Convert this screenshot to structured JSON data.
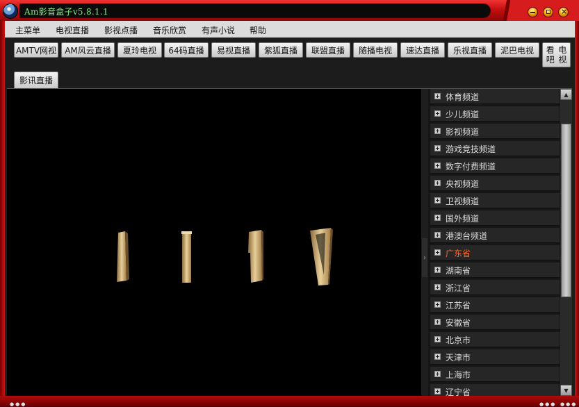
{
  "window": {
    "title": "Am影音盒子v5.8.1.1",
    "controls": {
      "minimize": "minimize-icon",
      "maximize": "maximize-icon",
      "close": "close-icon"
    }
  },
  "menu": {
    "items": [
      "主菜单",
      "电视直播",
      "影视点播",
      "音乐欣赏",
      "有声小说",
      "帮助"
    ]
  },
  "channel_buttons": {
    "row1": [
      "AMTV网视",
      "AM风云直播",
      "夏玲电视",
      "64码直播",
      "易视直播",
      "紫狐直播",
      "联盟直播",
      "随播电视",
      "速达直播",
      "乐视直播",
      "泥巴电视"
    ],
    "tall": {
      "line1": "看吧",
      "line2": "电视"
    },
    "active_tab": "影讯直播"
  },
  "channel_list": {
    "categories": [
      "体育频道",
      "少儿频道",
      "影视频道",
      "游戏竞技频道",
      "数字付费频道",
      "央视频道",
      "卫视频道",
      "国外频道",
      "港澳台频道",
      "广东省",
      "湖南省",
      "浙江省",
      "江苏省",
      "安徽省",
      "北京市",
      "天津市",
      "上海市",
      "辽宁省"
    ],
    "highlighted": "广东省"
  },
  "colors": {
    "title_red": "#c40f0f",
    "title_text": "#7cf07c",
    "highlight": "#ff6a2a",
    "list_row": "#262626"
  }
}
